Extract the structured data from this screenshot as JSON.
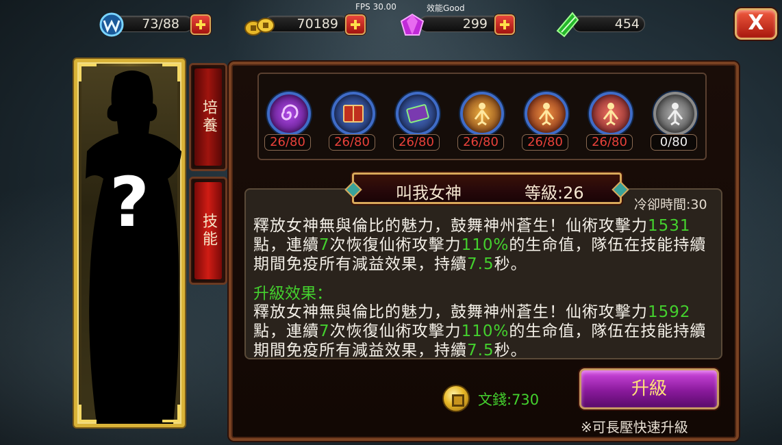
{
  "hud": {
    "fps": "FPS 30.00",
    "performance": "效能Good",
    "stamina": "73/88",
    "gold": "70189",
    "gems": "299",
    "jade": "454",
    "close_label": "X"
  },
  "portrait": {
    "placeholder": "?"
  },
  "tabs": [
    {
      "label": "培養",
      "active": false
    },
    {
      "label": "技能",
      "active": true
    }
  ],
  "skills": [
    {
      "icon": "swirl-skill-icon",
      "level": "26/80",
      "color": "#7a2bb8"
    },
    {
      "icon": "red-book-icon",
      "level": "26/80",
      "color": "#a02a1e"
    },
    {
      "icon": "purple-book-icon",
      "level": "26/80",
      "color": "#6a3aa0"
    },
    {
      "icon": "golden-figure-icon",
      "level": "26/80",
      "color": "#c8762a"
    },
    {
      "icon": "golden-figure-icon",
      "level": "26/80",
      "color": "#c0663a"
    },
    {
      "icon": "golden-figure-icon",
      "level": "26/80",
      "color": "#b0563a"
    },
    {
      "icon": "grey-figure-icon",
      "level": "0/80",
      "color": "#7a7a7a"
    }
  ],
  "skill_detail": {
    "name": "叫我女神",
    "level": "等級:26",
    "cooldown": "冷卻時間:30",
    "current": {
      "t1": "釋放女神無與倫比的魅力，鼓舞神州蒼生！仙術攻擊力",
      "v1": "1531",
      "t2": "點，連續",
      "v2": "7",
      "t3": "次恢復仙術攻擊力",
      "v3": "110%",
      "t4": "的生命值，隊伍在技能持續期間免疫所有減益效果，持續",
      "v4": "7.5",
      "t5": "秒。"
    },
    "upgrade_label": "升級效果：",
    "next": {
      "t1": "釋放女神無與倫比的魅力，鼓舞神州蒼生！仙術攻擊力",
      "v1": "1592",
      "t2": "點，連續",
      "v2": "7",
      "t3": "次恢復仙術攻擊力",
      "v3": "110%",
      "t4": "的生命值，隊伍在技能持續期間免疫所有減益效果，持續",
      "v4": "7.5",
      "t5": "秒。"
    }
  },
  "cost": {
    "label": "文錢:730"
  },
  "upgrade_button": "升級",
  "hint": "※可長壓快速升級"
}
